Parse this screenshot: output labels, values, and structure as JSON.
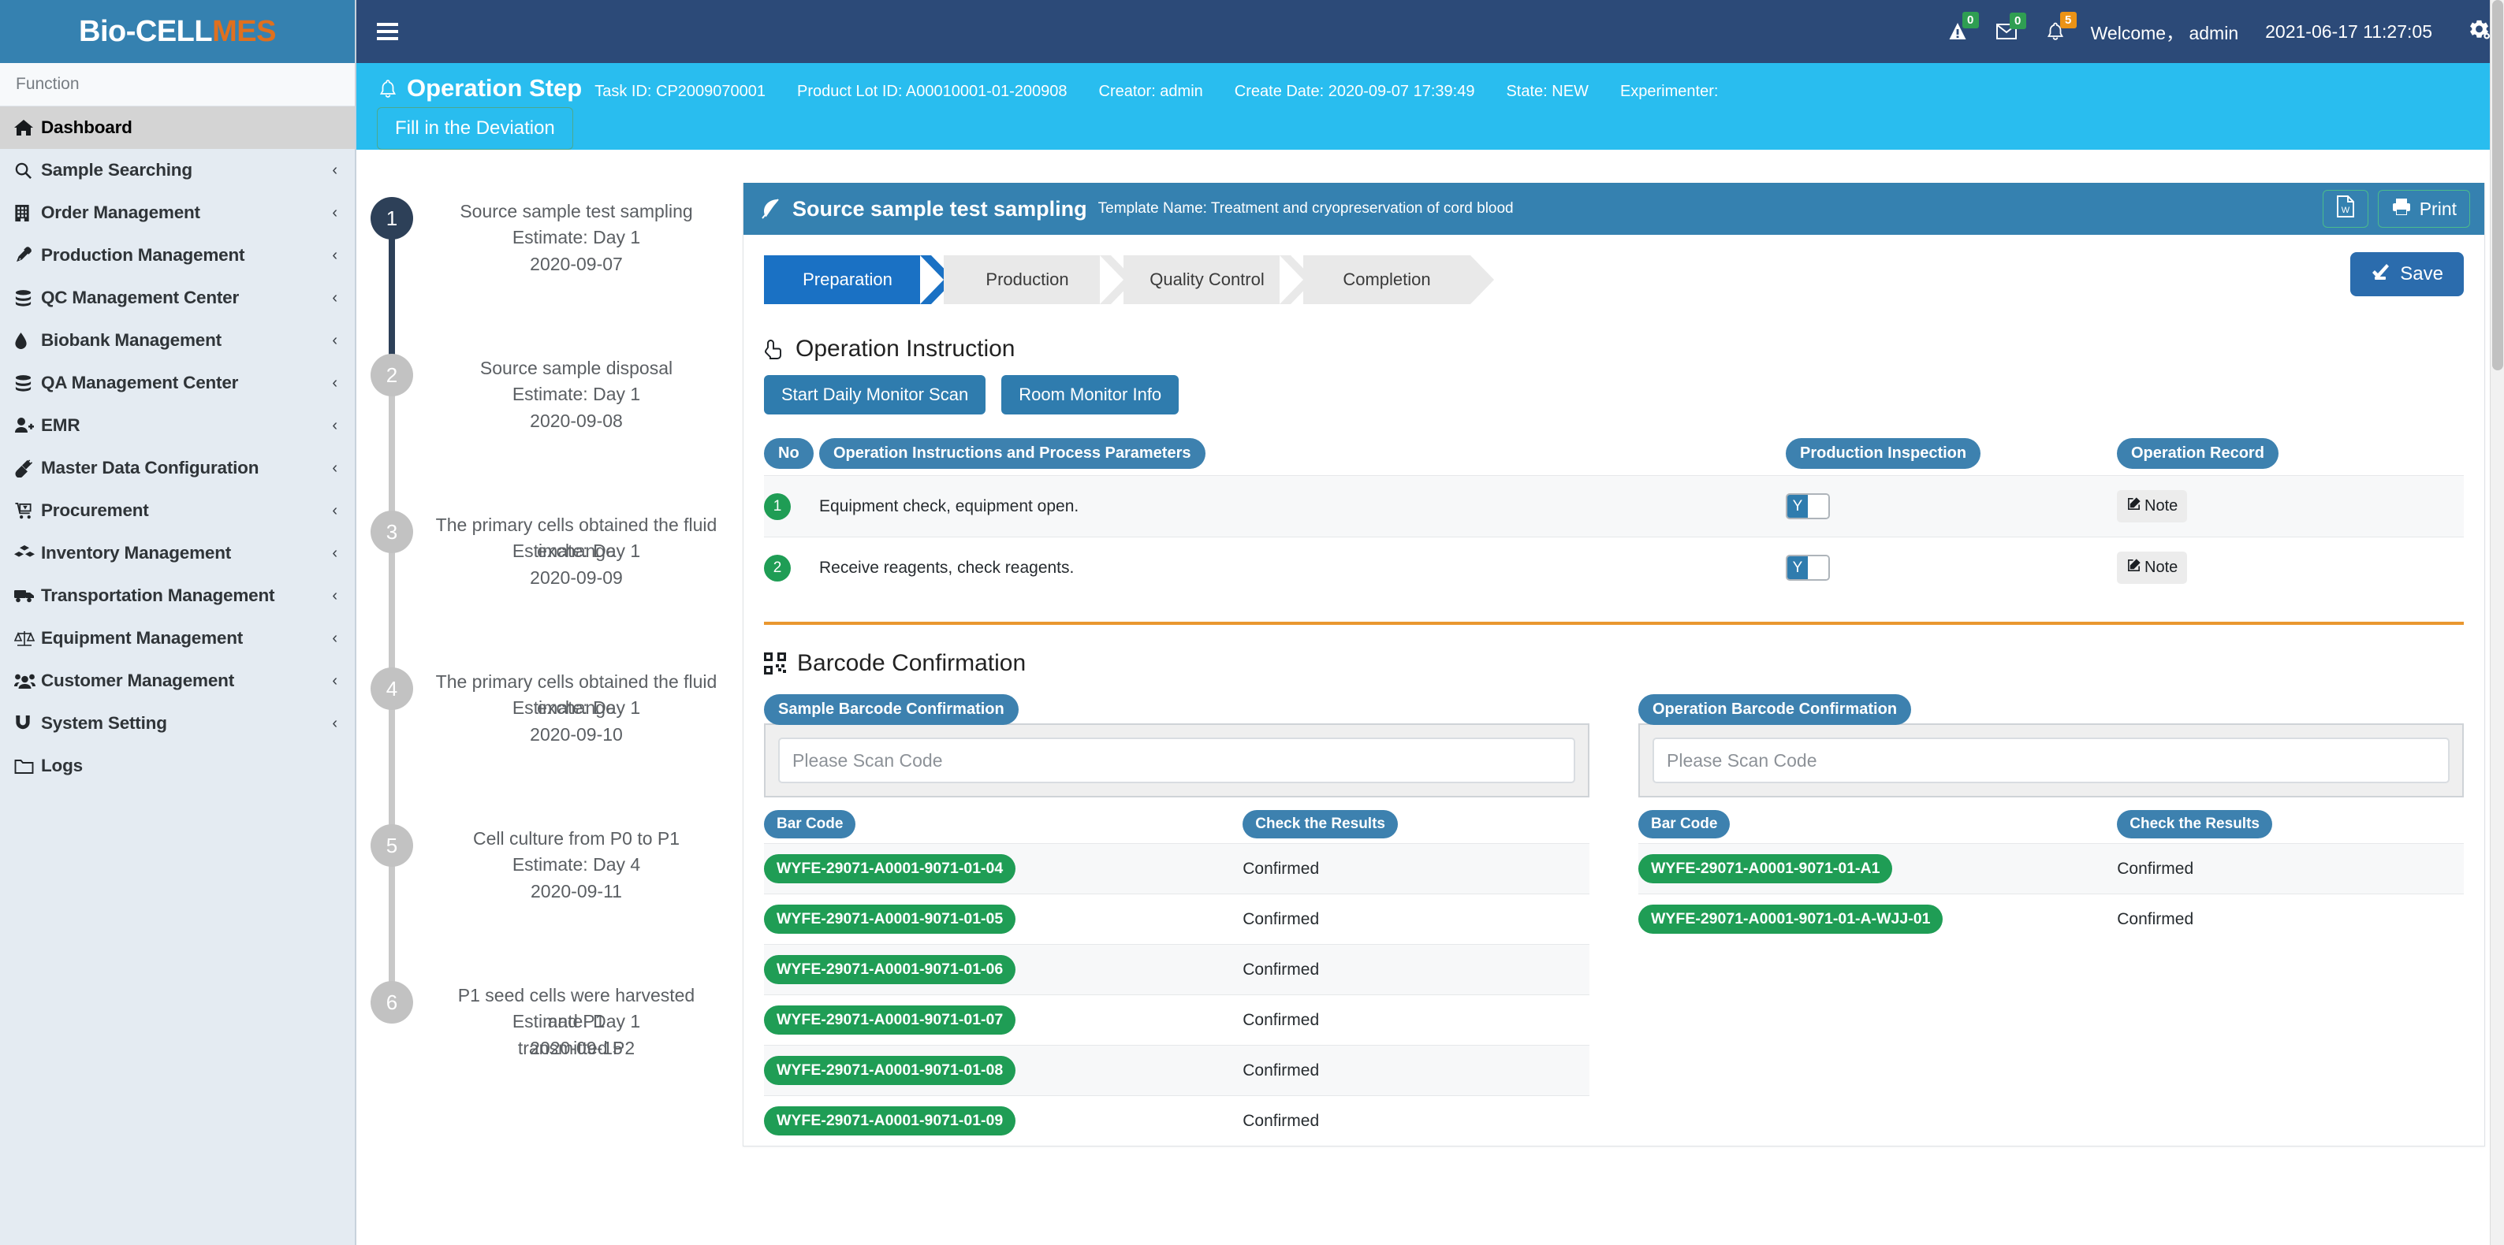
{
  "brand": {
    "white": "Bio-CELL",
    "orange": "MES"
  },
  "sidebar": {
    "function_label": "Function",
    "items": [
      {
        "label": "Dashboard",
        "icon": "home-icon",
        "caret": "",
        "active": true
      },
      {
        "label": "Sample Searching",
        "icon": "search-icon",
        "caret": "‹"
      },
      {
        "label": "Order Management",
        "icon": "building-icon",
        "caret": "‹"
      },
      {
        "label": "Production Management",
        "icon": "pipette-icon",
        "caret": "‹"
      },
      {
        "label": "QC Management Center",
        "icon": "database-icon",
        "caret": "‹"
      },
      {
        "label": "Biobank Management",
        "icon": "droplet-icon",
        "caret": "‹"
      },
      {
        "label": "QA Management Center",
        "icon": "database-icon",
        "caret": "‹"
      },
      {
        "label": "EMR",
        "icon": "user-plus-icon",
        "caret": "‹"
      },
      {
        "label": "Master Data Configuration",
        "icon": "plug-icon",
        "caret": "‹"
      },
      {
        "label": "Procurement",
        "icon": "cart-icon",
        "caret": "‹"
      },
      {
        "label": "Inventory Management",
        "icon": "boxes-icon",
        "caret": "‹"
      },
      {
        "label": "Transportation Management",
        "icon": "truck-icon",
        "caret": "‹"
      },
      {
        "label": "Equipment Management",
        "icon": "balance-icon",
        "caret": "‹"
      },
      {
        "label": "Customer Management",
        "icon": "users-icon",
        "caret": "‹"
      },
      {
        "label": "System Setting",
        "icon": "magnet-icon",
        "caret": "‹"
      },
      {
        "label": "Logs",
        "icon": "folder-icon",
        "caret": ""
      }
    ]
  },
  "topbar": {
    "warning_count": "0",
    "mail_count": "0",
    "bell_count": "5",
    "welcome": "Welcome， admin",
    "datetime": "2021-06-17 11:27:05"
  },
  "opstep": {
    "title": "Operation Step",
    "task_id": "Task ID: CP2009070001",
    "product_lot_id": "Product Lot ID: A00010001-01-200908",
    "creator": "Creator: admin",
    "create_date": "Create Date: 2020-09-07 17:39:49",
    "state": "State: NEW",
    "experimenter": "Experimenter:",
    "deviation_btn": "Fill in the Deviation"
  },
  "timeline": [
    {
      "num": "1",
      "name": "Source sample test sampling",
      "estimate": "Estimate: Day 1",
      "date": "2020-09-07",
      "overlap": "",
      "active": true
    },
    {
      "num": "2",
      "name": "Source sample disposal",
      "estimate": "Estimate: Day 1",
      "date": "2020-09-08",
      "overlap": ""
    },
    {
      "num": "3",
      "name": "The primary cells obtained the fluid",
      "estimate": "Estimate: Day 1",
      "date": "2020-09-09",
      "overlap": "exchange"
    },
    {
      "num": "4",
      "name": "The primary cells obtained the fluid",
      "estimate": "Estimate: Day 1",
      "date": "2020-09-10",
      "overlap": "exchange"
    },
    {
      "num": "5",
      "name": "Cell culture from P0 to P1",
      "estimate": "Estimate: Day 4",
      "date": "2020-09-11",
      "overlap": ""
    },
    {
      "num": "6",
      "name": "P1 seed cells were harvested",
      "estimate": "Estimate: Day 1",
      "date": "2020-09-15",
      "overlap": "and P1",
      "overlap2": "transmitted P2"
    }
  ],
  "card": {
    "title": "Source sample test sampling",
    "subtitle": "Template Name: Treatment and cryopreservation of cord blood",
    "word_btn": "W",
    "print_btn": "Print",
    "save_btn": "Save"
  },
  "steps": [
    {
      "label": "Preparation",
      "active": true
    },
    {
      "label": "Production",
      "active": false
    },
    {
      "label": "Quality Control",
      "active": false
    },
    {
      "label": "Completion",
      "active": false
    }
  ],
  "operation_instruction": {
    "title": "Operation Instruction",
    "buttons": [
      "Start Daily Monitor Scan",
      "Room Monitor Info"
    ],
    "columns": [
      "No",
      "Operation Instructions and Process Parameters",
      "Production Inspection",
      "Operation Record"
    ],
    "rows": [
      {
        "no": "1",
        "instruction": "Equipment check, equipment open.",
        "inspection": "Y",
        "record": "Note"
      },
      {
        "no": "2",
        "instruction": "Receive reagents, check reagents.",
        "inspection": "Y",
        "record": "Note"
      }
    ]
  },
  "barcode": {
    "title": "Barcode Confirmation",
    "sample_panel": {
      "label": "Sample Barcode Confirmation",
      "placeholder": "Please Scan Code",
      "value": "",
      "columns": [
        "Bar Code",
        "Check the Results"
      ],
      "rows": [
        {
          "code": "WYFE-29071-A0001-9071-01-04",
          "result": "Confirmed"
        },
        {
          "code": "WYFE-29071-A0001-9071-01-05",
          "result": "Confirmed"
        },
        {
          "code": "WYFE-29071-A0001-9071-01-06",
          "result": "Confirmed"
        },
        {
          "code": "WYFE-29071-A0001-9071-01-07",
          "result": "Confirmed"
        },
        {
          "code": "WYFE-29071-A0001-9071-01-08",
          "result": "Confirmed"
        },
        {
          "code": "WYFE-29071-A0001-9071-01-09",
          "result": "Confirmed"
        }
      ]
    },
    "operation_panel": {
      "label": "Operation Barcode Confirmation",
      "placeholder": "Please Scan Code",
      "value": "",
      "columns": [
        "Bar Code",
        "Check the Results"
      ],
      "rows": [
        {
          "code": "WYFE-29071-A0001-9071-01-A1",
          "result": "Confirmed"
        },
        {
          "code": "WYFE-29071-A0001-9071-01-A-WJJ-01",
          "result": "Confirmed"
        }
      ]
    }
  },
  "colors": {
    "brand_blue": "#3581b0",
    "brand_orange": "#e0701e",
    "topbar": "#2c4a78",
    "opstep_cyan": "#29bdef",
    "accent_blue": "#1a71c4",
    "green": "#1f9d55",
    "orange_rule": "#e9972f"
  }
}
